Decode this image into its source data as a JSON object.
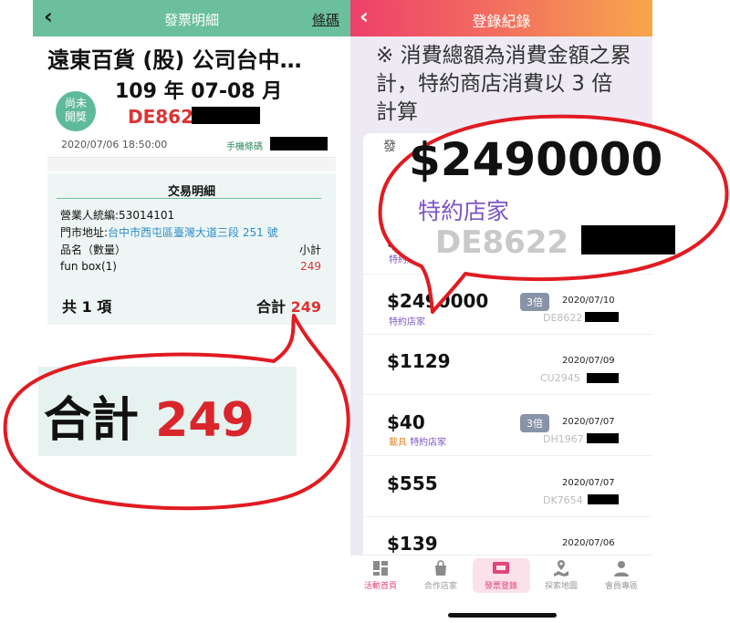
{
  "left_screen": {
    "header": {
      "back": "‹",
      "title": "發票明細",
      "barcode_link": "條碼"
    },
    "company": "遠東百貨 (股) 公司台中…",
    "period": "109 年 07-08 月",
    "status_badge": "尚未\n開獎",
    "invoice_number": "DE862",
    "datetime": "2020/07/06 18:50:00",
    "carrier_label": "手機條碼",
    "transaction": {
      "title": "交易明細",
      "tax_id": "營業人統編:53014101",
      "address_label": "門市地址:",
      "address_value": "台中市西屯區臺灣大道三段 251 號",
      "item_header": "品名（數量）",
      "subtotal_header": "小計",
      "items": [
        {
          "name": "fun box(1)",
          "price": "249"
        }
      ],
      "count": "共 1 項",
      "total_label": "合計",
      "total_value": "249"
    },
    "zoom": {
      "total_label": "合計",
      "total_value": "249"
    }
  },
  "right_screen": {
    "header": {
      "back": "‹",
      "title": "登錄紀錄"
    },
    "note": "※ 消費總額為消費金額之累計，特約商店消費以 3 倍計算",
    "tab_peek": "發",
    "records": [
      {
        "amount": "$",
        "sub": "特約店",
        "badge": "",
        "date": "",
        "invoice": ""
      },
      {
        "amount": "$2490000",
        "carrier": "",
        "store": "特約店家",
        "badge": "3倍",
        "date": "2020/07/10",
        "invoice": "DE8622"
      },
      {
        "amount": "$1129",
        "carrier": "",
        "store": "",
        "badge": "",
        "date": "2020/07/09",
        "invoice": "CU2945"
      },
      {
        "amount": "$40",
        "carrier": "載具",
        "store": "特約店家",
        "badge": "3倍",
        "date": "2020/07/07",
        "invoice": "DH1967"
      },
      {
        "amount": "$555",
        "carrier": "",
        "store": "",
        "badge": "",
        "date": "2020/07/07",
        "invoice": "DK7654"
      },
      {
        "amount": "$139",
        "carrier": "",
        "store": "",
        "badge": "",
        "date": "2020/07/06",
        "invoice": ""
      }
    ],
    "bottom_nav": [
      {
        "label": "活動首頁",
        "icon": "dashboard-icon"
      },
      {
        "label": "合作店家",
        "icon": "shopping-bag-icon"
      },
      {
        "label": "發票登錄",
        "icon": "ticket-icon",
        "active": true
      },
      {
        "label": "探索地圖",
        "icon": "map-icon"
      },
      {
        "label": "會員專區",
        "icon": "user-icon"
      }
    ],
    "zoom": {
      "amount": "$2490000",
      "store": "特約店家",
      "invoice": "DE8622"
    }
  },
  "colors": {
    "left_header": "#6bbf9d",
    "right_header_start": "#ee3f6a",
    "right_header_end": "#f6a74a",
    "red": "#d33333",
    "purple": "#7b56c6",
    "callout_border": "#e11b22"
  }
}
